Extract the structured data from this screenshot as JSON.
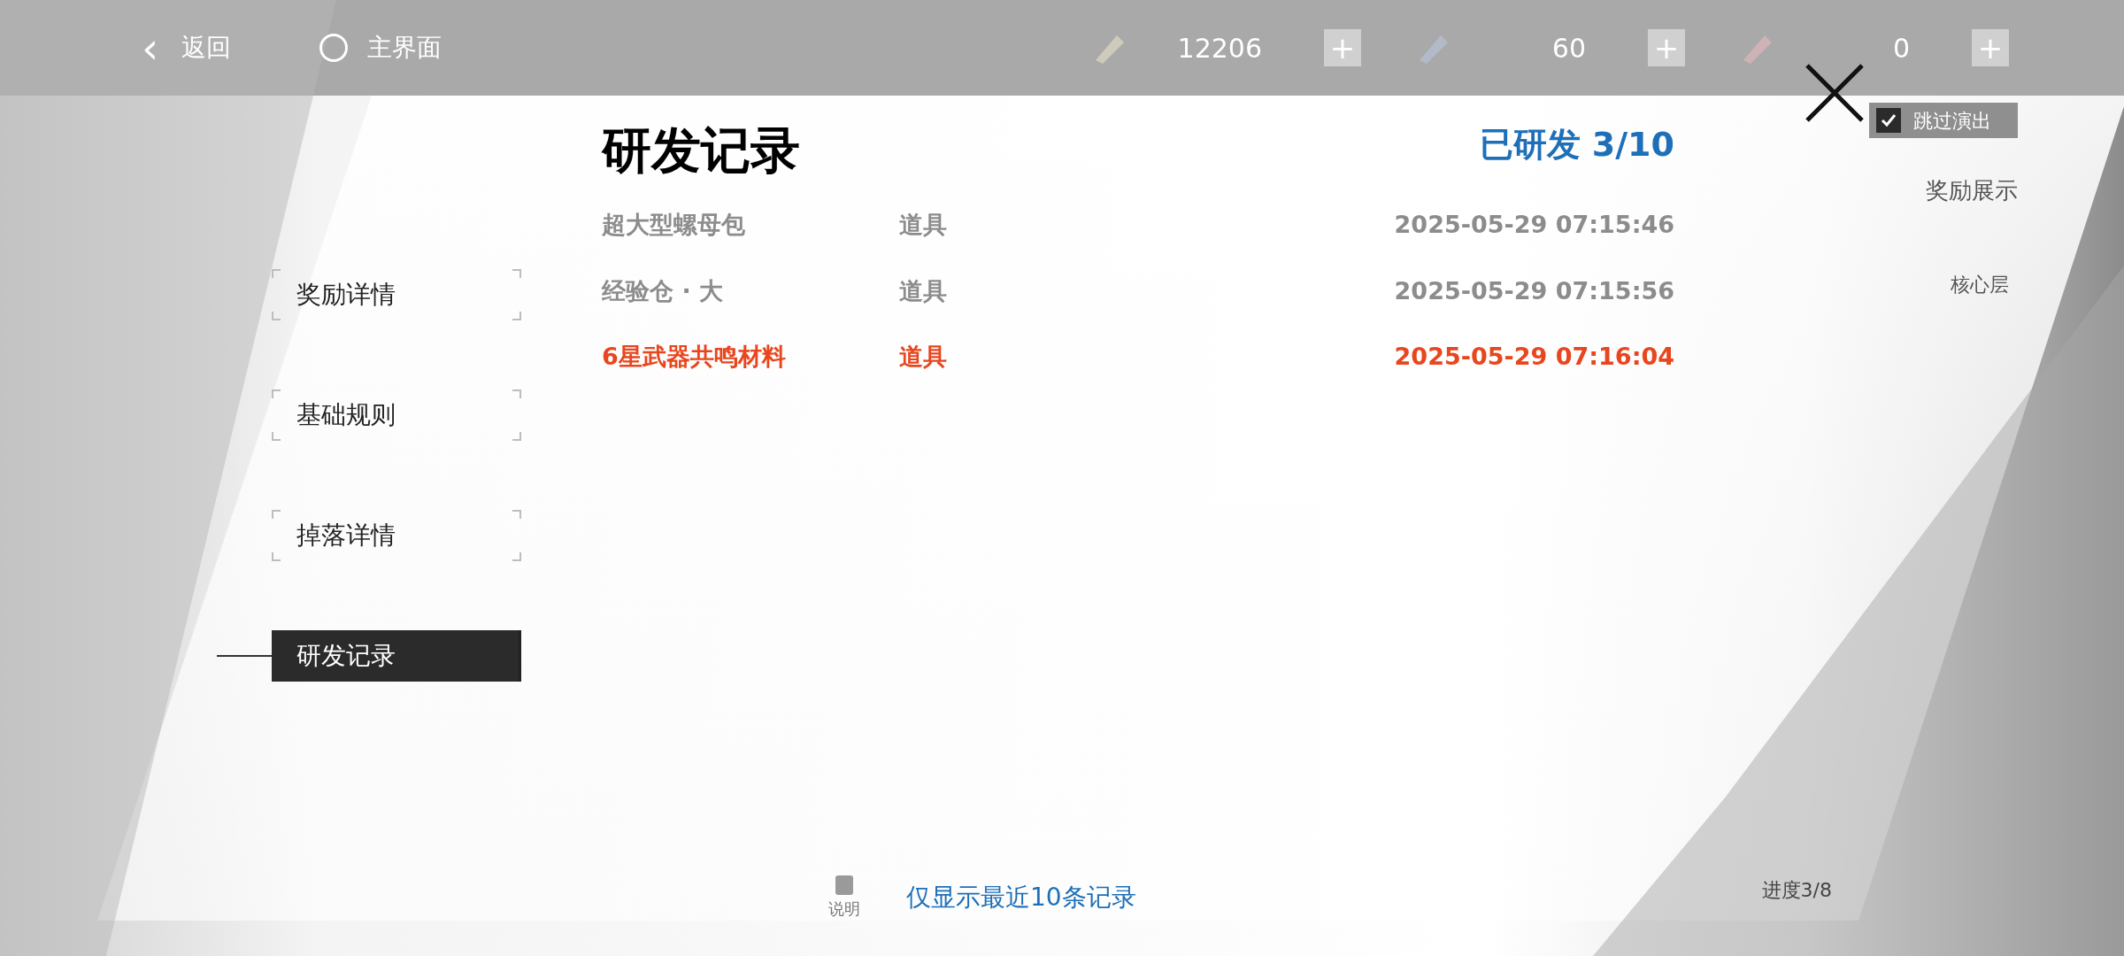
{
  "top_bar": {
    "back": {
      "icon": "‹",
      "label": "返回"
    },
    "home": {
      "label": "主界面"
    },
    "currencies": [
      {
        "amount": "12206",
        "plus": "+"
      },
      {
        "amount": "60",
        "plus": "+"
      },
      {
        "amount": "0",
        "plus": "+"
      }
    ]
  },
  "side_menu": [
    {
      "label": "奖励详情",
      "selected": false
    },
    {
      "label": "基础规则",
      "selected": false
    },
    {
      "label": "掉落详情",
      "selected": false
    },
    {
      "label": "研发记录",
      "selected": true
    }
  ],
  "panel": {
    "title": "研发记录",
    "summary": "已研发 3/10",
    "records": [
      {
        "name": "超大型螺母包",
        "type": "道具",
        "time": "2025-05-29 07:15:46",
        "kind": "normal"
      },
      {
        "name": "经验仓 · 大",
        "type": "道具",
        "time": "2025-05-29 07:15:56",
        "kind": "normal"
      },
      {
        "name": "6星武器共鸣材料",
        "type": "道具",
        "time": "2025-05-29 07:16:04",
        "kind": "rare"
      }
    ],
    "footer_note": "仅显示最近10条记录"
  },
  "background_ui": {
    "skip": {
      "label": "跳过演出",
      "checked": true
    },
    "rewards": "奖励展示",
    "layer": "核心层",
    "help": "说明",
    "progress": "进度3/8"
  }
}
